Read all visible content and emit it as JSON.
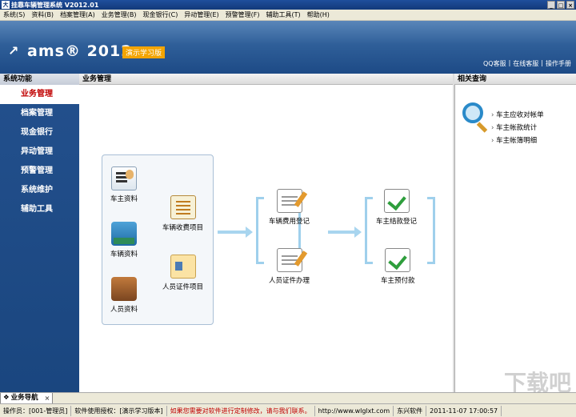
{
  "window": {
    "title": "挂靠车辆管理系统 V2012.01"
  },
  "menu": [
    "系统(S)",
    "资料(B)",
    "档案管理(A)",
    "业务管理(B)",
    "现金银行(C)",
    "异动管理(E)",
    "预警管理(F)",
    "辅助工具(T)",
    "帮助(H)"
  ],
  "banner": {
    "logo": "ams",
    "year": "2012",
    "edition": "演示学习版",
    "links": [
      "QQ客服",
      "|",
      "在线客服",
      "|",
      "操作手册"
    ]
  },
  "sidebar": {
    "header": "系统功能",
    "items": [
      {
        "label": "业务管理",
        "active": true
      },
      {
        "label": "档案管理"
      },
      {
        "label": "现金银行"
      },
      {
        "label": "异动管理"
      },
      {
        "label": "预警管理"
      },
      {
        "label": "系统维护"
      },
      {
        "label": "辅助工具"
      }
    ]
  },
  "main": {
    "header": "业务管理",
    "nodes": {
      "owner": "车主资料",
      "vehicle": "车辆资料",
      "staff": "人员资料",
      "fee_items": "车辆收费项目",
      "cert_items": "人员证件项目",
      "fee_register": "车辆费用登记",
      "cert_process": "人员证件办理",
      "settle_register": "车主结款登记",
      "prepay": "车主预付款"
    }
  },
  "related": {
    "header": "相关查询",
    "items": [
      "车主应收对帐单",
      "车主帐款统计",
      "车主帐簿明细"
    ]
  },
  "tabbar": {
    "active_tab": "业务导航"
  },
  "status": {
    "operator": "操作员：[001-管理员]",
    "license": "软件使用授权：[演示学习版本]",
    "notice": "如果您需要对软件进行定制修改，请与我们联系。",
    "url": "http://www.wlglxt.com",
    "company": "东兴软件",
    "datetime": "2011-11-07 17:00:57"
  },
  "watermark": "下载吧"
}
